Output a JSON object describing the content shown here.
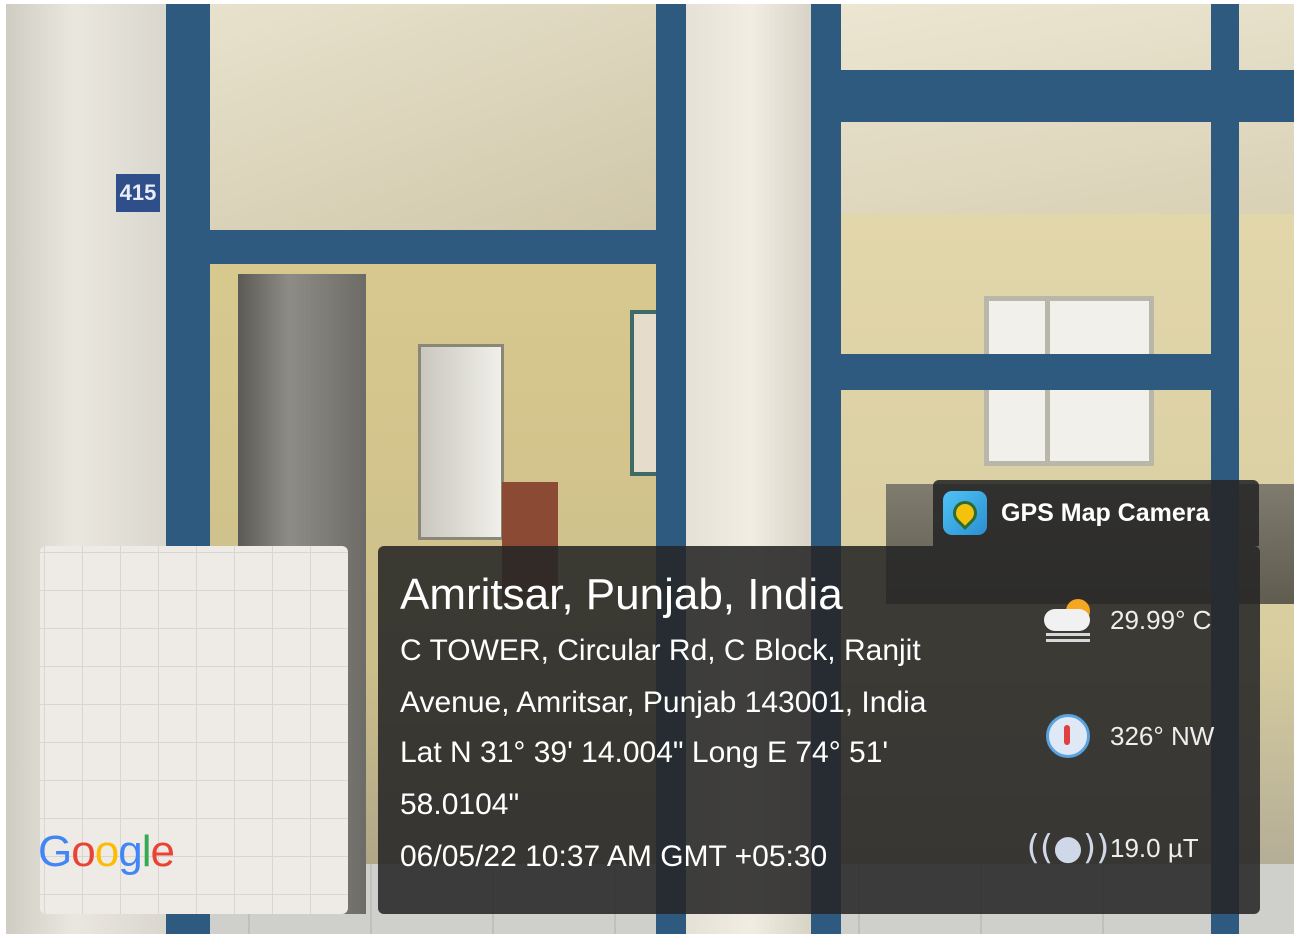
{
  "room_sign": "415",
  "map_thumbnail": {
    "brand": "Google"
  },
  "app_badge": {
    "name": "GPS Map Camera",
    "icon": "map-pin-icon"
  },
  "location": {
    "title": "Amritsar, Punjab, India",
    "address_line_1": "C TOWER, Circular Rd, C Block, Ranjit",
    "address_line_2": "Avenue, Amritsar, Punjab 143001, India",
    "coords_line_1": "Lat N 31° 39' 14.004\" Long E 74° 51'",
    "coords_line_2": "58.0104\"",
    "timestamp": "06/05/22 10:37 AM GMT +05:30"
  },
  "readings": {
    "temperature": "29.99° C",
    "heading": "326° NW",
    "magnetic_field": "19.0 µT"
  },
  "icons": [
    "weather-icon",
    "compass-icon",
    "magnetometer-icon"
  ]
}
